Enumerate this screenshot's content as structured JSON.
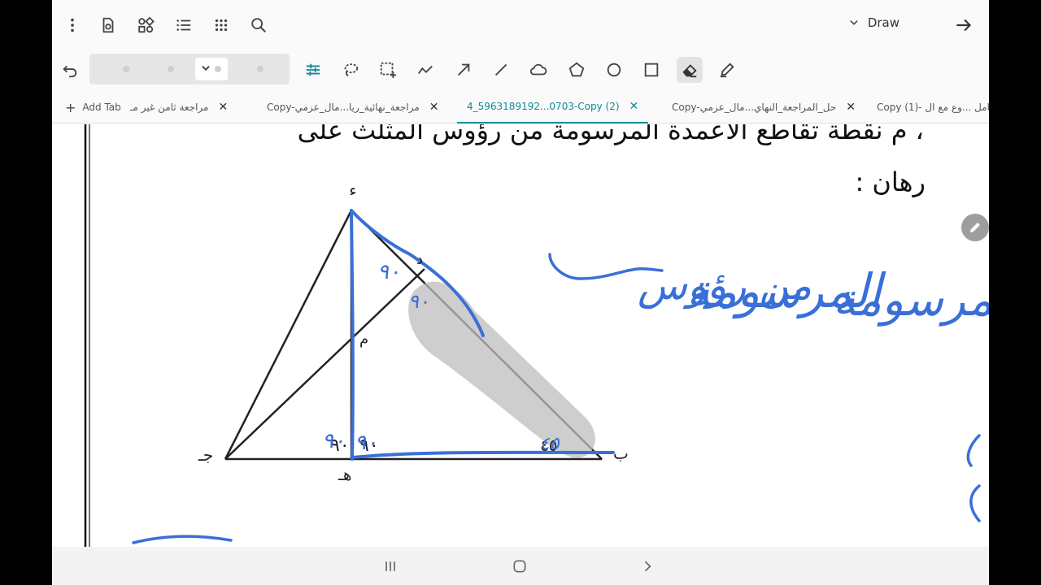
{
  "toolbar": {
    "icons": [
      "more-vert-icon",
      "page-settings-icon",
      "shapes-icon",
      "list-icon",
      "apps-grid-icon",
      "search-icon"
    ],
    "mode_label": "Draw",
    "colors": {
      "accent": "#0e8a96",
      "ink": "#3a6fd8",
      "icon": "#444444"
    }
  },
  "drawing_tools": [
    "undo-icon",
    "adjust-icon",
    "lasso-icon",
    "select-rect-icon",
    "scribble-icon",
    "arrow-icon",
    "line-icon",
    "cloud-shape-icon",
    "pentagon-icon",
    "circle-icon",
    "rectangle-icon",
    "eraser-icon",
    "pen-icon"
  ],
  "tabs": {
    "add_label": "Add Tab",
    "items": [
      {
        "label": "مراجعة ثامن غير مـ",
        "active": false
      },
      {
        "label": "Copy-مراجعة_نهائية_ريا...مال_عزمي",
        "active": false
      },
      {
        "label": "4_5963189192...0703-Copy (2)",
        "active": true
      },
      {
        "label": "Copy-حل_المراجعة_النهاي...مال_عزمي",
        "active": false
      },
      {
        "label": "Copy (1)- شامل ...وع مع ال",
        "active": false
      }
    ]
  },
  "document": {
    "line1": "، م نقطة تقاطع الأعمدة المرسومة من رؤوس المثلث على",
    "line2": "رهان :",
    "labels": {
      "vertex_top": "ء",
      "vertex_left": "جـ",
      "vertex_right": "ب",
      "vertex_foot": "هـ",
      "point_m": "م",
      "point_d": "د",
      "angle_left": "٩٠",
      "angle_right": "٩٠",
      "angle_base": "٤٥"
    }
  },
  "handwriting": {
    "text_1": "من رؤوس",
    "text_2": "المرسومة",
    "text_3": "ة المرسومة",
    "angle_d": "٩٠",
    "angle_d2": "٩٠",
    "angle_foot_left": "٩٠",
    "angle_foot_right": "٩٠",
    "angle_b": "٤٥"
  },
  "nav": [
    "recents-icon",
    "home-icon",
    "back-icon"
  ]
}
